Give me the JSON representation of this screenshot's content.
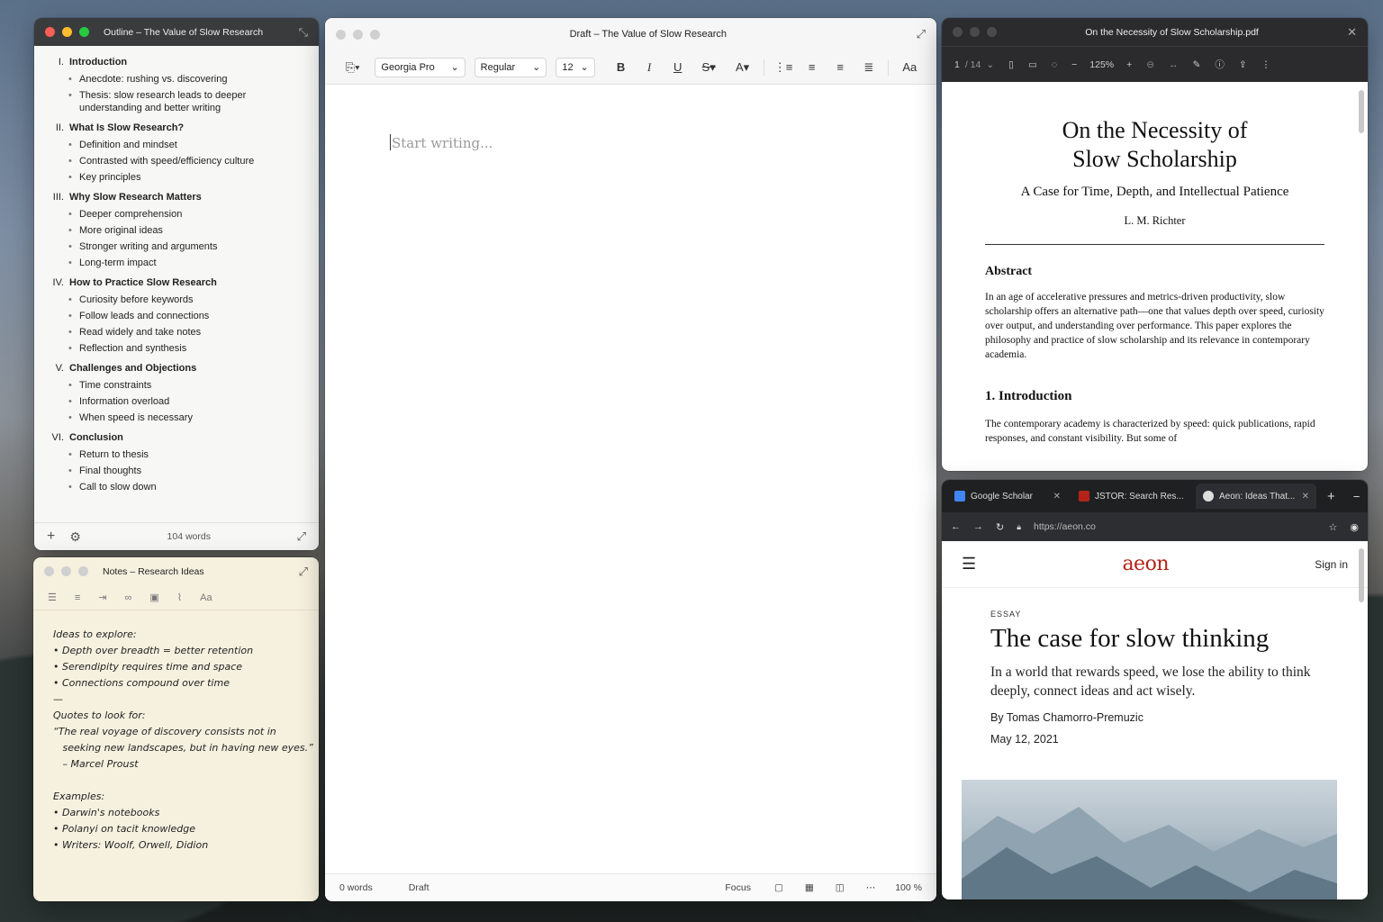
{
  "outline": {
    "title": "Outline – The Value of Slow Research",
    "sections": [
      {
        "num": "I.",
        "title": "Introduction",
        "items": [
          "Anecdote: rushing vs. discovering",
          "Thesis: slow research leads to deeper understanding and better writing"
        ]
      },
      {
        "num": "II.",
        "title": "What Is Slow Research?",
        "items": [
          "Definition and mindset",
          "Contrasted with speed/efficiency culture",
          "Key principles"
        ]
      },
      {
        "num": "III.",
        "title": "Why Slow Research Matters",
        "items": [
          "Deeper comprehension",
          "More original ideas",
          "Stronger writing and arguments",
          "Long-term impact"
        ]
      },
      {
        "num": "IV.",
        "title": "How to Practice Slow Research",
        "items": [
          "Curiosity before keywords",
          "Follow leads and connections",
          "Read widely and take notes",
          "Reflection and synthesis"
        ]
      },
      {
        "num": "V.",
        "title": "Challenges and Objections",
        "items": [
          "Time constraints",
          "Information overload",
          "When speed is necessary"
        ]
      },
      {
        "num": "VI.",
        "title": "Conclusion",
        "items": [
          "Return to thesis",
          "Final thoughts",
          "Call to slow down"
        ]
      }
    ],
    "word_count": "104 words"
  },
  "notes": {
    "title": "Notes – Research Ideas",
    "format_label": "Aa",
    "lines": [
      "Ideas to explore:",
      "• Depth over breadth = better retention",
      "• Serendipity requires time and space",
      "• Connections compound over time",
      "—",
      "Quotes to look for:",
      "“The real voyage of discovery consists not in",
      "   seeking new landscapes, but in having new eyes.”",
      "   – Marcel Proust",
      "",
      "Examples:",
      "• Darwin's notebooks",
      "• Polanyi on tacit knowledge",
      "• Writers: Woolf, Orwell, Didion"
    ]
  },
  "draft": {
    "title": "Draft – The Value of Slow Research",
    "font": "Georgia Pro",
    "weight": "Regular",
    "size": "12",
    "format_label": "Aa",
    "placeholder": "Start writing...",
    "word_count": "0 words",
    "status": "Draft",
    "focus": "Focus",
    "zoom": "100 %"
  },
  "pdf": {
    "title": "On the Necessity of Slow Scholarship.pdf",
    "page": "1",
    "pages": "/ 14",
    "zoom": "125%",
    "doc_title_1": "On the Necessity of",
    "doc_title_2": "Slow Scholarship",
    "subtitle": "A Case for Time, Depth, and Intellectual Patience",
    "author": "L. M. Richter",
    "abstract_heading": "Abstract",
    "abstract": "In an age of accelerative pressures and metrics-driven productivity, slow scholarship offers an alternative path—one that values depth over speed, curiosity over output, and understanding over performance. This paper explores the philosophy and practice of slow scholarship and its relevance in contemporary academia.",
    "intro_heading": "1. Introduction",
    "intro": "The contemporary academy is characterized by speed: quick publications, rapid responses, and constant visibility. But some of"
  },
  "browser": {
    "tabs": [
      {
        "label": "Google Scholar",
        "color": "#4285f4"
      },
      {
        "label": "JSTOR: Search Res...",
        "color": "#b42318"
      },
      {
        "label": "Aeon: Ideas That...",
        "color": "#dddddd"
      }
    ],
    "url": "https://aeon.co",
    "logo": "aeon",
    "signin": "Sign in",
    "kicker": "ESSAY",
    "headline": "The case for slow thinking",
    "dek": "In a world that rewards speed, we lose the ability to think deeply, connect ideas and act wisely.",
    "byline": "By Tomas Chamorro-Premuzic",
    "date": "May 12, 2021"
  }
}
